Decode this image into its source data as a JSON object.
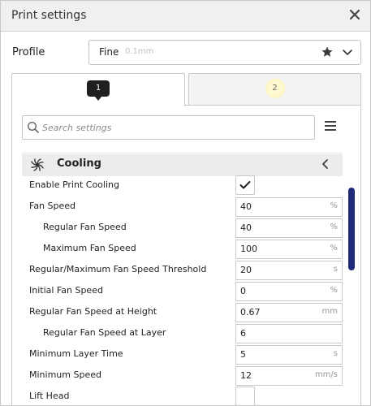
{
  "window": {
    "title": "Print settings"
  },
  "profile": {
    "label": "Profile",
    "selected_name": "Fine",
    "selected_layer_height": "0.1mm"
  },
  "tabs": [
    {
      "badge": "1",
      "active": true
    },
    {
      "badge": "2",
      "active": false
    }
  ],
  "search": {
    "placeholder": "Search settings",
    "value": ""
  },
  "section": {
    "name": "Cooling"
  },
  "settings": [
    {
      "label": "Enable Print Cooling",
      "type": "checkbox",
      "checked": true
    },
    {
      "label": "Fan Speed",
      "type": "number",
      "value": "40",
      "unit": "%"
    },
    {
      "label": "Regular Fan Speed",
      "type": "number",
      "value": "40",
      "unit": "%"
    },
    {
      "label": "Maximum Fan Speed",
      "type": "number",
      "value": "100",
      "unit": "%"
    },
    {
      "label": "Regular/Maximum Fan Speed Threshold",
      "type": "number",
      "value": "20",
      "unit": "s"
    },
    {
      "label": "Initial Fan Speed",
      "type": "number",
      "value": "0",
      "unit": "%"
    },
    {
      "label": "Regular Fan Speed at Height",
      "type": "number",
      "value": "0.67",
      "unit": "mm"
    },
    {
      "label": "Regular Fan Speed at Layer",
      "type": "number",
      "value": "6",
      "unit": ""
    },
    {
      "label": "Minimum Layer Time",
      "type": "number",
      "value": "5",
      "unit": "s"
    },
    {
      "label": "Minimum Speed",
      "type": "number",
      "value": "12",
      "unit": "mm/s"
    },
    {
      "label": "Lift Head",
      "type": "checkbox",
      "checked": false
    }
  ],
  "colors": {
    "accent": "#1e2a78",
    "tab_badge": "#1f1f1f",
    "tab2_highlight": "#fff9cf"
  }
}
